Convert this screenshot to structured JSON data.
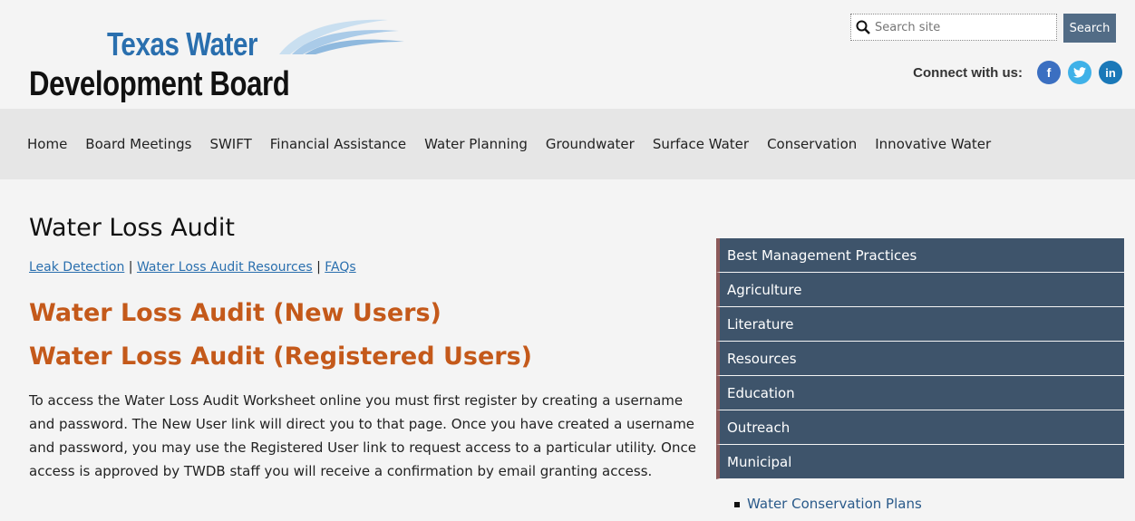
{
  "logo": {
    "line1": "Texas Water",
    "line2": "Development Board"
  },
  "search": {
    "placeholder": "Search site",
    "button_label": "Search"
  },
  "connect": {
    "label": "Connect with us:",
    "icons": [
      "facebook-icon",
      "twitter-icon",
      "linkedin-icon"
    ],
    "facebook": "f",
    "linkedin": "in"
  },
  "nav": {
    "items": [
      "Home",
      "Board Meetings",
      "SWIFT",
      "Financial Assistance",
      "Water Planning",
      "Groundwater",
      "Surface Water",
      "Conservation",
      "Innovative Water"
    ]
  },
  "main": {
    "title": "Water Loss Audit",
    "sublinks": [
      "Leak Detection",
      "Water Loss Audit Resources",
      "FAQs"
    ],
    "separator": "|",
    "link_new": "Water Loss Audit (New Users)",
    "link_registered": "Water Loss Audit (Registered Users)",
    "paragraph": "To access the Water Loss Audit Worksheet online you must first register by creating a username and password.  The New User link will direct you to that page.  Once you have created a username and password, you may use the Registered User link to request access to a particular utility.  Once access is approved by TWDB staff you will receive a confirmation by email granting access."
  },
  "sidebar": {
    "items": [
      "Best Management Practices",
      "Agriculture",
      "Literature",
      "Resources",
      "Education",
      "Outreach",
      "Municipal"
    ],
    "subitems": [
      "Water Conservation Plans"
    ]
  },
  "colors": {
    "accent": "#c4591a",
    "link": "#2a6fae",
    "sidebar_bg": "#3e546b",
    "search_button": "#526c86"
  }
}
